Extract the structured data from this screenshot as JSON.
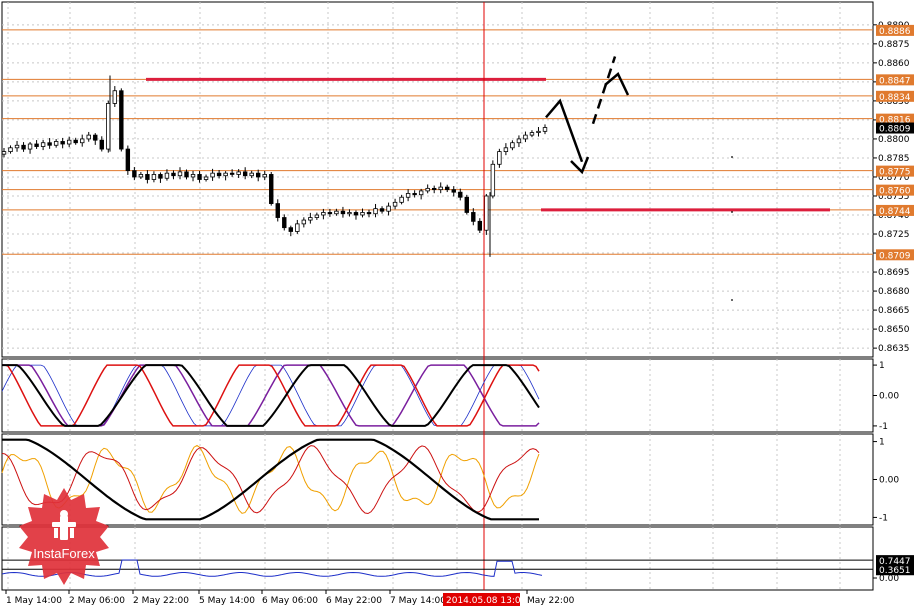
{
  "chart_data": [
    {
      "type": "candlestick",
      "panel": "price",
      "ylim": [
        0.8628,
        0.8908
      ],
      "y_ticks": [
        "0.8890",
        "0.8875",
        "0.8860",
        "0.8845",
        "0.8830",
        "0.8815",
        "0.8800",
        "0.8785",
        "0.8770",
        "0.8755",
        "0.8740",
        "0.8725",
        "0.8710",
        "0.8695",
        "0.8680",
        "0.8665",
        "0.8650",
        "0.8635"
      ],
      "level_lines": [
        0.8886,
        0.8847,
        0.8834,
        0.8816,
        0.8775,
        0.876,
        0.8744,
        0.8709
      ],
      "level_labels": [
        "0.8886",
        "0.8847",
        "0.8834",
        "0.8816",
        "0.8775",
        "0.8760",
        "0.8744",
        "0.8709"
      ],
      "current_price": "0.8809",
      "level_color": "#e07a2e",
      "resistance_color": "#dc1e3c",
      "resistance_level": 0.8847,
      "support_level": 0.8744,
      "closes": [
        0.879,
        0.8793,
        0.8795,
        0.8792,
        0.8796,
        0.8794,
        0.8797,
        0.8795,
        0.8798,
        0.8796,
        0.8799,
        0.8797,
        0.88,
        0.8803,
        0.8799,
        0.8792,
        0.8828,
        0.8838,
        0.8792,
        0.8775,
        0.877,
        0.8772,
        0.8768,
        0.8772,
        0.8769,
        0.8773,
        0.8771,
        0.8774,
        0.877,
        0.8772,
        0.8768,
        0.877,
        0.8773,
        0.8771,
        0.8773,
        0.8772,
        0.8774,
        0.8771,
        0.8773,
        0.877,
        0.8772,
        0.8749,
        0.8738,
        0.873,
        0.8727,
        0.8733,
        0.8736,
        0.8738,
        0.874,
        0.8742,
        0.8741,
        0.8743,
        0.8741,
        0.8742,
        0.874,
        0.8742,
        0.8741,
        0.8745,
        0.8743,
        0.8747,
        0.875,
        0.8754,
        0.8757,
        0.8756,
        0.8759,
        0.8761,
        0.876,
        0.8762,
        0.876,
        0.8758,
        0.8754,
        0.8742,
        0.8735,
        0.8728,
        0.8755,
        0.878,
        0.879,
        0.8793,
        0.8797,
        0.88,
        0.8803,
        0.8805,
        0.8806,
        0.8809
      ]
    },
    {
      "type": "line",
      "panel": "oscillator-1",
      "y_ticks": [
        "1",
        "0.00",
        "-1"
      ],
      "ylim": [
        -1.2,
        1.2
      ],
      "series_colors": [
        "#000000",
        "#dd1111",
        "#7a1f9e",
        "#1d2fc9"
      ]
    },
    {
      "type": "line",
      "panel": "oscillator-2",
      "y_ticks": [
        "1",
        "0.00",
        "-1"
      ],
      "ylim": [
        -1.2,
        1.2
      ],
      "series_colors": [
        "#000000",
        "#cc1111",
        "#f0a000"
      ]
    },
    {
      "type": "line",
      "panel": "oscillator-3",
      "y_ticks": [
        "0.00"
      ],
      "level_labels": [
        "0.7447",
        "0.3651"
      ],
      "series_colors": [
        "#1d2fc9"
      ]
    }
  ],
  "x_axis": {
    "labels": [
      "1 May 14:00",
      "2 May 06:00",
      "2 May 22:00",
      "5 May 14:00",
      "6 May 06:00",
      "6 May 22:00",
      "7 May 14:00",
      "May 22:00"
    ],
    "crosshair_label": "2014.05.08 13:00"
  },
  "brand": {
    "name": "InstaForex"
  }
}
